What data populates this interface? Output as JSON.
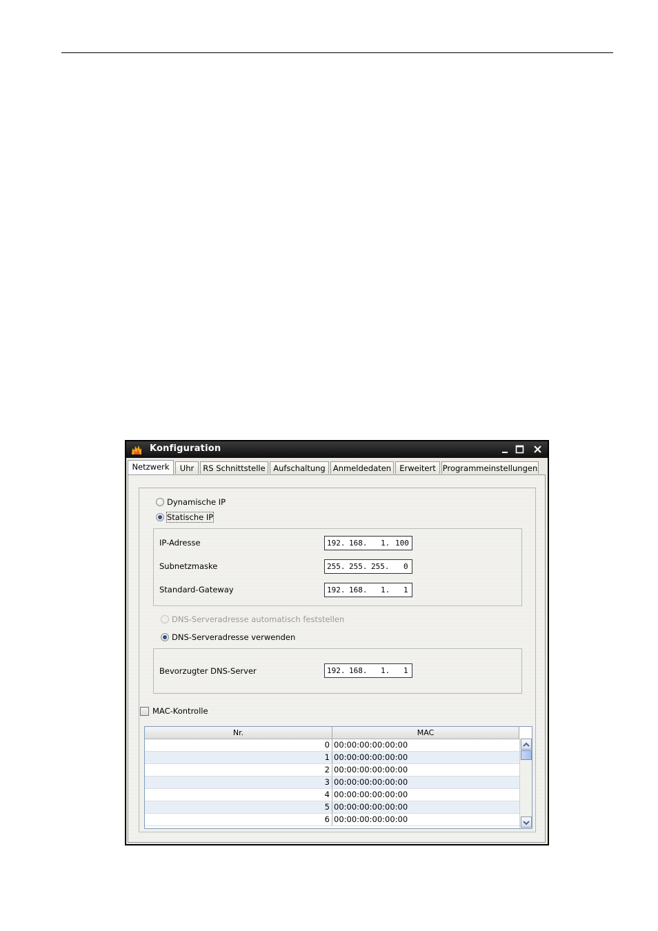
{
  "window": {
    "title": "Konfiguration",
    "minimize_label": "minimize",
    "maximize_label": "maximize",
    "close_label": "close"
  },
  "tabs": [
    {
      "label": "Netzwerk",
      "active": true
    },
    {
      "label": "Uhr"
    },
    {
      "label": "RS Schnittstelle"
    },
    {
      "label": "Aufschaltung"
    },
    {
      "label": "Anmeldedaten"
    },
    {
      "label": "Erweitert"
    },
    {
      "label": "Programmeinstellungen"
    }
  ],
  "network": {
    "dynamic_ip_label": "Dynamische IP",
    "static_ip_label": "Statische IP",
    "ip_label": "IP-Adresse",
    "ip_value": [
      "192.",
      "168.",
      "1.",
      "100"
    ],
    "subnet_label": "Subnetzmaske",
    "subnet_value": [
      "255.",
      "255.",
      "255.",
      "0"
    ],
    "gateway_label": "Standard-Gateway",
    "gateway_value": [
      "192.",
      "168.",
      "1.",
      "1"
    ],
    "dns_auto_label": "DNS-Serveradresse automatisch feststellen",
    "dns_manual_label": "DNS-Serveradresse verwenden",
    "dns_pref_label": "Bevorzugter DNS-Server",
    "dns_pref_value": [
      "192.",
      "168.",
      "1.",
      "1"
    ]
  },
  "mac": {
    "checkbox_label": "MAC-Kontrolle",
    "columns": [
      "Nr.",
      "MAC"
    ],
    "rows": [
      {
        "nr": "0",
        "mac": "00:00:00:00:00:00"
      },
      {
        "nr": "1",
        "mac": "00:00:00:00:00:00"
      },
      {
        "nr": "2",
        "mac": "00:00:00:00:00:00"
      },
      {
        "nr": "3",
        "mac": "00:00:00:00:00:00"
      },
      {
        "nr": "4",
        "mac": "00:00:00:00:00:00"
      },
      {
        "nr": "5",
        "mac": "00:00:00:00:00:00"
      },
      {
        "nr": "6",
        "mac": "00:00:00:00:00:00"
      }
    ]
  }
}
